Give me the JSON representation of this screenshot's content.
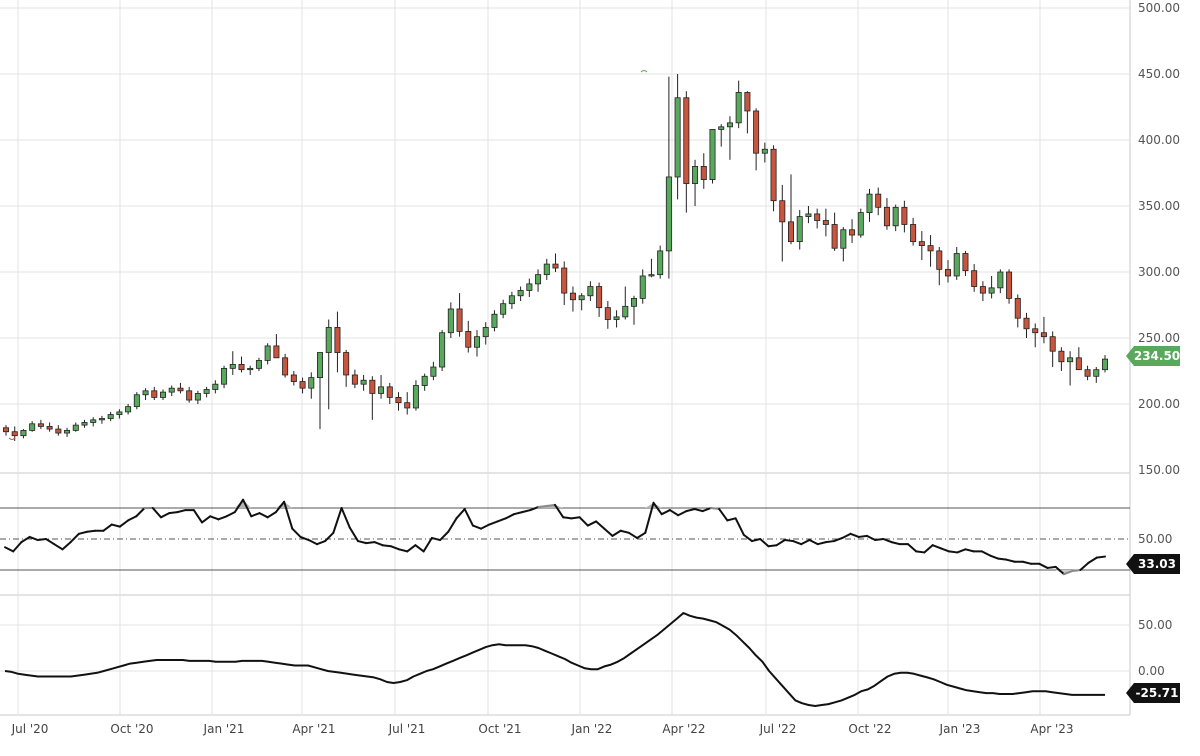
{
  "chart_data": [
    {
      "type": "candlestick",
      "interval": "weekly",
      "ylim": [
        150,
        500
      ],
      "y_ticks": [
        "500.00",
        "450.00",
        "400.00",
        "350.00",
        "300.00",
        "250.00",
        "200.00",
        "150.00"
      ],
      "last_value_label": "234.50",
      "up_color": "#5aa85e",
      "down_color": "#c8553d",
      "candles": [
        [
          182,
          184,
          176,
          179
        ],
        [
          179,
          183,
          172,
          176
        ],
        [
          176,
          181,
          174,
          180
        ],
        [
          180,
          187,
          179,
          185
        ],
        [
          185,
          188,
          181,
          183
        ],
        [
          183,
          186,
          179,
          181
        ],
        [
          181,
          184,
          176,
          178
        ],
        [
          178,
          182,
          175,
          180
        ],
        [
          180,
          186,
          179,
          184
        ],
        [
          184,
          188,
          182,
          186
        ],
        [
          186,
          190,
          183,
          188
        ],
        [
          188,
          191,
          185,
          189
        ],
        [
          189,
          194,
          187,
          192
        ],
        [
          192,
          196,
          189,
          194
        ],
        [
          194,
          200,
          192,
          198
        ],
        [
          198,
          209,
          196,
          207
        ],
        [
          207,
          212,
          203,
          210
        ],
        [
          210,
          213,
          203,
          205
        ],
        [
          205,
          211,
          203,
          209
        ],
        [
          209,
          214,
          206,
          212
        ],
        [
          212,
          216,
          208,
          210
        ],
        [
          210,
          213,
          201,
          203
        ],
        [
          203,
          210,
          200,
          208
        ],
        [
          208,
          213,
          205,
          211
        ],
        [
          211,
          218,
          208,
          215
        ],
        [
          215,
          229,
          212,
          227
        ],
        [
          227,
          240,
          222,
          230
        ],
        [
          230,
          236,
          224,
          226
        ],
        [
          226,
          229,
          222,
          227
        ],
        [
          227,
          235,
          225,
          233
        ],
        [
          233,
          246,
          230,
          244
        ],
        [
          244,
          253,
          238,
          235
        ],
        [
          235,
          238,
          220,
          222
        ],
        [
          222,
          225,
          214,
          217
        ],
        [
          217,
          220,
          208,
          212
        ],
        [
          212,
          224,
          204,
          220
        ],
        [
          220,
          234,
          181,
          239
        ],
        [
          239,
          264,
          196,
          258
        ],
        [
          258,
          270,
          224,
          239
        ],
        [
          239,
          241,
          213,
          222
        ],
        [
          222,
          226,
          212,
          215
        ],
        [
          215,
          222,
          210,
          218
        ],
        [
          218,
          221,
          188,
          208
        ],
        [
          208,
          222,
          204,
          213
        ],
        [
          213,
          216,
          200,
          205
        ],
        [
          205,
          209,
          195,
          201
        ],
        [
          201,
          209,
          192,
          197
        ],
        [
          197,
          218,
          195,
          214
        ],
        [
          214,
          223,
          210,
          221
        ],
        [
          221,
          232,
          218,
          228
        ],
        [
          228,
          256,
          225,
          254
        ],
        [
          254,
          277,
          250,
          272
        ],
        [
          272,
          284,
          251,
          255
        ],
        [
          255,
          263,
          239,
          243
        ],
        [
          243,
          256,
          236,
          251
        ],
        [
          251,
          262,
          245,
          258
        ],
        [
          258,
          271,
          255,
          268
        ],
        [
          268,
          279,
          265,
          276
        ],
        [
          276,
          285,
          272,
          282
        ],
        [
          282,
          289,
          278,
          286
        ],
        [
          286,
          295,
          281,
          291
        ],
        [
          291,
          302,
          285,
          298
        ],
        [
          298,
          310,
          294,
          306
        ],
        [
          306,
          314,
          300,
          303
        ],
        [
          303,
          308,
          275,
          284
        ],
        [
          284,
          289,
          270,
          279
        ],
        [
          279,
          284,
          271,
          282
        ],
        [
          282,
          293,
          278,
          289
        ],
        [
          289,
          292,
          266,
          273
        ],
        [
          273,
          278,
          257,
          264
        ],
        [
          264,
          271,
          258,
          266
        ],
        [
          266,
          289,
          264,
          274
        ],
        [
          274,
          282,
          260,
          280
        ],
        [
          280,
          302,
          276,
          297
        ],
        [
          297,
          310,
          296,
          298
        ],
        [
          298,
          320,
          295,
          316
        ],
        [
          316,
          448,
          295,
          372
        ],
        [
          372,
          450,
          355,
          432
        ],
        [
          432,
          437,
          345,
          367
        ],
        [
          367,
          385,
          350,
          380
        ],
        [
          380,
          390,
          363,
          370
        ],
        [
          370,
          398,
          367,
          408
        ],
        [
          408,
          412,
          395,
          410
        ],
        [
          410,
          418,
          385,
          413
        ],
        [
          413,
          445,
          409,
          436
        ],
        [
          436,
          437,
          405,
          422
        ],
        [
          422,
          424,
          377,
          390
        ],
        [
          390,
          398,
          383,
          393
        ],
        [
          393,
          396,
          346,
          354
        ],
        [
          354,
          366,
          308,
          338
        ],
        [
          338,
          374,
          321,
          323
        ],
        [
          323,
          347,
          317,
          342
        ],
        [
          342,
          350,
          337,
          344
        ],
        [
          344,
          348,
          333,
          339
        ],
        [
          339,
          348,
          327,
          336
        ],
        [
          336,
          345,
          316,
          318
        ],
        [
          318,
          334,
          308,
          332
        ],
        [
          332,
          340,
          322,
          328
        ],
        [
          328,
          348,
          326,
          345
        ],
        [
          345,
          363,
          338,
          359
        ],
        [
          359,
          364,
          343,
          349
        ],
        [
          349,
          356,
          332,
          335
        ],
        [
          335,
          351,
          331,
          349
        ],
        [
          349,
          354,
          330,
          336
        ],
        [
          336,
          341,
          320,
          323
        ],
        [
          323,
          331,
          309,
          320
        ],
        [
          320,
          328,
          304,
          316
        ],
        [
          316,
          319,
          290,
          302
        ],
        [
          302,
          309,
          292,
          297
        ],
        [
          297,
          319,
          294,
          314
        ],
        [
          314,
          316,
          297,
          301
        ],
        [
          301,
          306,
          285,
          289
        ],
        [
          289,
          293,
          278,
          284
        ],
        [
          284,
          297,
          280,
          288
        ],
        [
          288,
          302,
          284,
          300
        ],
        [
          300,
          302,
          276,
          280
        ],
        [
          280,
          283,
          258,
          265
        ],
        [
          265,
          269,
          250,
          257
        ],
        [
          257,
          261,
          243,
          254
        ],
        [
          254,
          266,
          246,
          251
        ],
        [
          251,
          255,
          228,
          240
        ],
        [
          240,
          243,
          225,
          232
        ],
        [
          232,
          240,
          214,
          235
        ],
        [
          235,
          243,
          230,
          226
        ],
        [
          226,
          229,
          218,
          221
        ],
        [
          221,
          228,
          216,
          226
        ],
        [
          226,
          237,
          224,
          234
        ]
      ]
    },
    {
      "type": "line",
      "indicator": "oscillator",
      "reference_lines": [
        80,
        50,
        20
      ],
      "y_ticks": [
        "50.00"
      ],
      "last_value_label": "33.03",
      "values": [
        42,
        38,
        47,
        52,
        49,
        50,
        45,
        40,
        47,
        55,
        57,
        58,
        58,
        64,
        62,
        68,
        72,
        80,
        80,
        71,
        75,
        76,
        78,
        78,
        66,
        72,
        69,
        72,
        76,
        88,
        72,
        75,
        71,
        76,
        86,
        60,
        52,
        49,
        45,
        48,
        56,
        80,
        61,
        48,
        46,
        47,
        44,
        43,
        40,
        38,
        44,
        38,
        51,
        49,
        57,
        70,
        79,
        63,
        60,
        64,
        67,
        70,
        74,
        76,
        78,
        81,
        82,
        83,
        71,
        70,
        71,
        63,
        67,
        60,
        53,
        58,
        56,
        51,
        56,
        85,
        74,
        78,
        73,
        77,
        79,
        77,
        80,
        79,
        68,
        70,
        54,
        48,
        50,
        43,
        44,
        49,
        48,
        45,
        49,
        45,
        47,
        48,
        51,
        55,
        52,
        53,
        49,
        50,
        47,
        45,
        45,
        38,
        37,
        44,
        41,
        38,
        37,
        40,
        38,
        38,
        34,
        31,
        30,
        28,
        28,
        26,
        26,
        22,
        23,
        16,
        19,
        20,
        27,
        32,
        33
      ]
    },
    {
      "type": "line",
      "indicator": "momentum",
      "y_ticks": [
        "50.00",
        "0.00"
      ],
      "last_value_label": "-25.71",
      "values": [
        0,
        -1,
        -3,
        -4,
        -5,
        -6,
        -6,
        -6,
        -6,
        -6,
        -6,
        -5,
        -4,
        -3,
        -2,
        0,
        2,
        4,
        6,
        8,
        9,
        10,
        11,
        12,
        12,
        12,
        12,
        12,
        11,
        11,
        11,
        11,
        10,
        10,
        10,
        10,
        11,
        11,
        11,
        11,
        10,
        9,
        8,
        7,
        6,
        6,
        6,
        4,
        2,
        0,
        -1,
        -2,
        -3,
        -4,
        -5,
        -6,
        -7,
        -9,
        -12,
        -13,
        -12,
        -10,
        -6,
        -3,
        0,
        2,
        5,
        8,
        11,
        14,
        17,
        20,
        23,
        26,
        28,
        29,
        28,
        28,
        28,
        28,
        27,
        25,
        22,
        19,
        16,
        13,
        9,
        6,
        3,
        2,
        2,
        5,
        7,
        10,
        14,
        19,
        24,
        29,
        34,
        39,
        45,
        51,
        57,
        63,
        60,
        58,
        57,
        55,
        53,
        49,
        45,
        39,
        32,
        25,
        17,
        10,
        0,
        -8,
        -16,
        -24,
        -32,
        -35,
        -37,
        -38,
        -37,
        -36,
        -34,
        -32,
        -29,
        -26,
        -22,
        -20,
        -16,
        -11,
        -6,
        -3,
        -2,
        -2,
        -3,
        -5,
        -7,
        -9,
        -12,
        -15,
        -17,
        -19,
        -21,
        -22,
        -23,
        -24,
        -24,
        -25,
        -25,
        -25,
        -24,
        -23,
        -22,
        -22,
        -22,
        -23,
        -24,
        -25,
        -26,
        -26,
        -26,
        -26,
        -26,
        -26
      ]
    }
  ],
  "x_axis": {
    "labels": [
      "Jul '20",
      "Oct '20",
      "Jan '21",
      "Apr '21",
      "Jul '21",
      "Oct '21",
      "Jan '22",
      "Apr '22",
      "Jul '22",
      "Oct '22",
      "Jan '23",
      "Apr '23"
    ]
  }
}
